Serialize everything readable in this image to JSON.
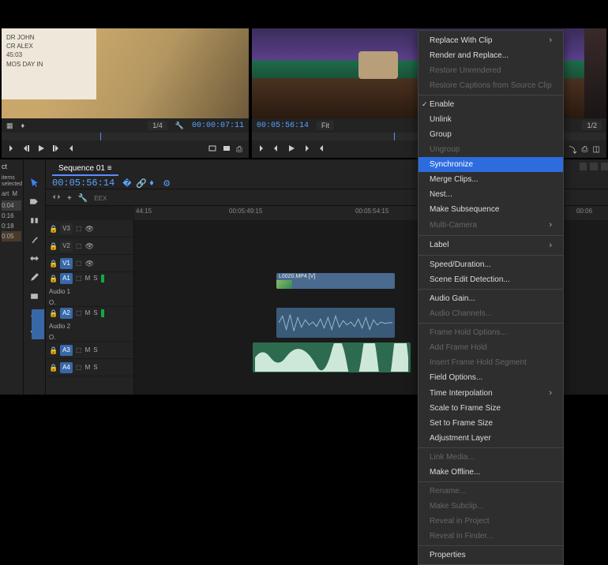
{
  "source_monitor": {
    "zoom": "1/4",
    "timecode": "00:00:07:11",
    "slate": {
      "line2": "DR JOHN",
      "line3": "CR ALEX",
      "line4": "45:03",
      "line5": "MOS DAY IN"
    }
  },
  "program_monitor": {
    "timecode": "00:05:56:14",
    "fit_label": "Fit",
    "zoom": "1/2"
  },
  "timeline": {
    "tab": "Sequence 01",
    "timecode": "00:05:56:14",
    "tool_mode": "EEX",
    "ruler": {
      "t1": "44:15",
      "t2": "00:05:49:15",
      "t3": "00:05:54:15",
      "t4": "00:06"
    },
    "tracks": {
      "v3": "V3",
      "v2": "V2",
      "v1": "V1",
      "a1": "A1",
      "a1_label": "Audio 1",
      "a2": "A2",
      "a2_label": "Audio 2",
      "a3": "A3",
      "a4": "A4",
      "ctrls": {
        "mute": "M",
        "solo": "S",
        "lock_glyph": "🔒",
        "eye_glyph": "👁",
        "o": "O."
      }
    },
    "clips": {
      "video_name": "L0020.MP4 [V]"
    }
  },
  "left_panel": {
    "header": "ct",
    "selected_text": "items selected",
    "tabs": {
      "art": "art",
      "m": "M"
    },
    "times": [
      "0:04",
      "0:16",
      "0:18",
      "0:05"
    ]
  },
  "context_menu": {
    "items": [
      {
        "label": "Replace With Clip",
        "sub": true
      },
      {
        "label": "Render and Replace..."
      },
      {
        "label": "Restore Unrendered",
        "disabled": true
      },
      {
        "label": "Restore Captions from Source Clip",
        "disabled": true
      },
      {
        "sep": true
      },
      {
        "label": "Enable",
        "checked": true
      },
      {
        "label": "Unlink"
      },
      {
        "label": "Group"
      },
      {
        "label": "Ungroup",
        "disabled": true
      },
      {
        "label": "Synchronize",
        "highlight": true
      },
      {
        "label": "Merge Clips..."
      },
      {
        "label": "Nest..."
      },
      {
        "label": "Make Subsequence"
      },
      {
        "label": "Multi-Camera",
        "disabled": true,
        "sub": true
      },
      {
        "sep": true
      },
      {
        "label": "Label",
        "sub": true
      },
      {
        "sep": true
      },
      {
        "label": "Speed/Duration..."
      },
      {
        "label": "Scene Edit Detection..."
      },
      {
        "sep": true
      },
      {
        "label": "Audio Gain..."
      },
      {
        "label": "Audio Channels...",
        "disabled": true
      },
      {
        "sep": true
      },
      {
        "label": "Frame Hold Options...",
        "disabled": true
      },
      {
        "label": "Add Frame Hold",
        "disabled": true
      },
      {
        "label": "Insert Frame Hold Segment",
        "disabled": true
      },
      {
        "label": "Field Options..."
      },
      {
        "label": "Time Interpolation",
        "sub": true
      },
      {
        "label": "Scale to Frame Size"
      },
      {
        "label": "Set to Frame Size"
      },
      {
        "label": "Adjustment Layer"
      },
      {
        "sep": true
      },
      {
        "label": "Link Media...",
        "disabled": true
      },
      {
        "label": "Make Offline..."
      },
      {
        "sep": true
      },
      {
        "label": "Rename...",
        "disabled": true
      },
      {
        "label": "Make Subclip...",
        "disabled": true
      },
      {
        "label": "Reveal in Project",
        "disabled": true
      },
      {
        "label": "Reveal in Finder...",
        "disabled": true
      },
      {
        "sep": true
      },
      {
        "label": "Properties"
      }
    ]
  }
}
